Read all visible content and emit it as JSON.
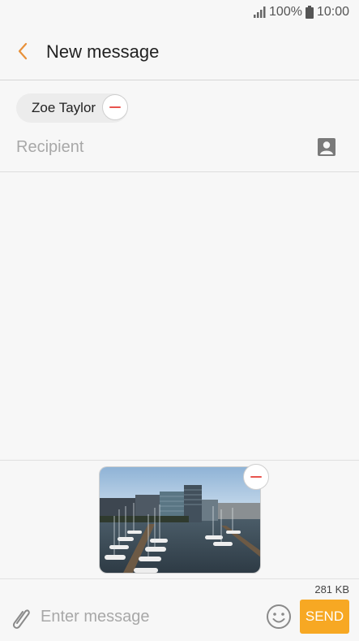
{
  "status_bar": {
    "battery_percent": "100%",
    "time": "10:00",
    "icons": [
      "signal-icon",
      "battery-icon"
    ]
  },
  "header": {
    "title": "New message",
    "back_icon": "chevron-left-icon"
  },
  "recipients": {
    "chips": [
      {
        "name": "Zoe Taylor",
        "remove_icon": "minus-circle-icon"
      }
    ],
    "placeholder": "Recipient",
    "contacts_icon": "contact-card-icon"
  },
  "attachment": {
    "kind": "image",
    "description_icon": "harbor-photo",
    "remove_icon": "minus-circle-icon"
  },
  "composer": {
    "size": "281 KB",
    "placeholder": "Enter message",
    "send_label": "SEND",
    "attach_icon": "paperclip-icon",
    "emoji_icon": "smiley-icon"
  },
  "colors": {
    "accent": "#f7a823",
    "back_arrow": "#e8913a",
    "remove_minus": "#e8544e",
    "background": "#f7f7f7"
  }
}
